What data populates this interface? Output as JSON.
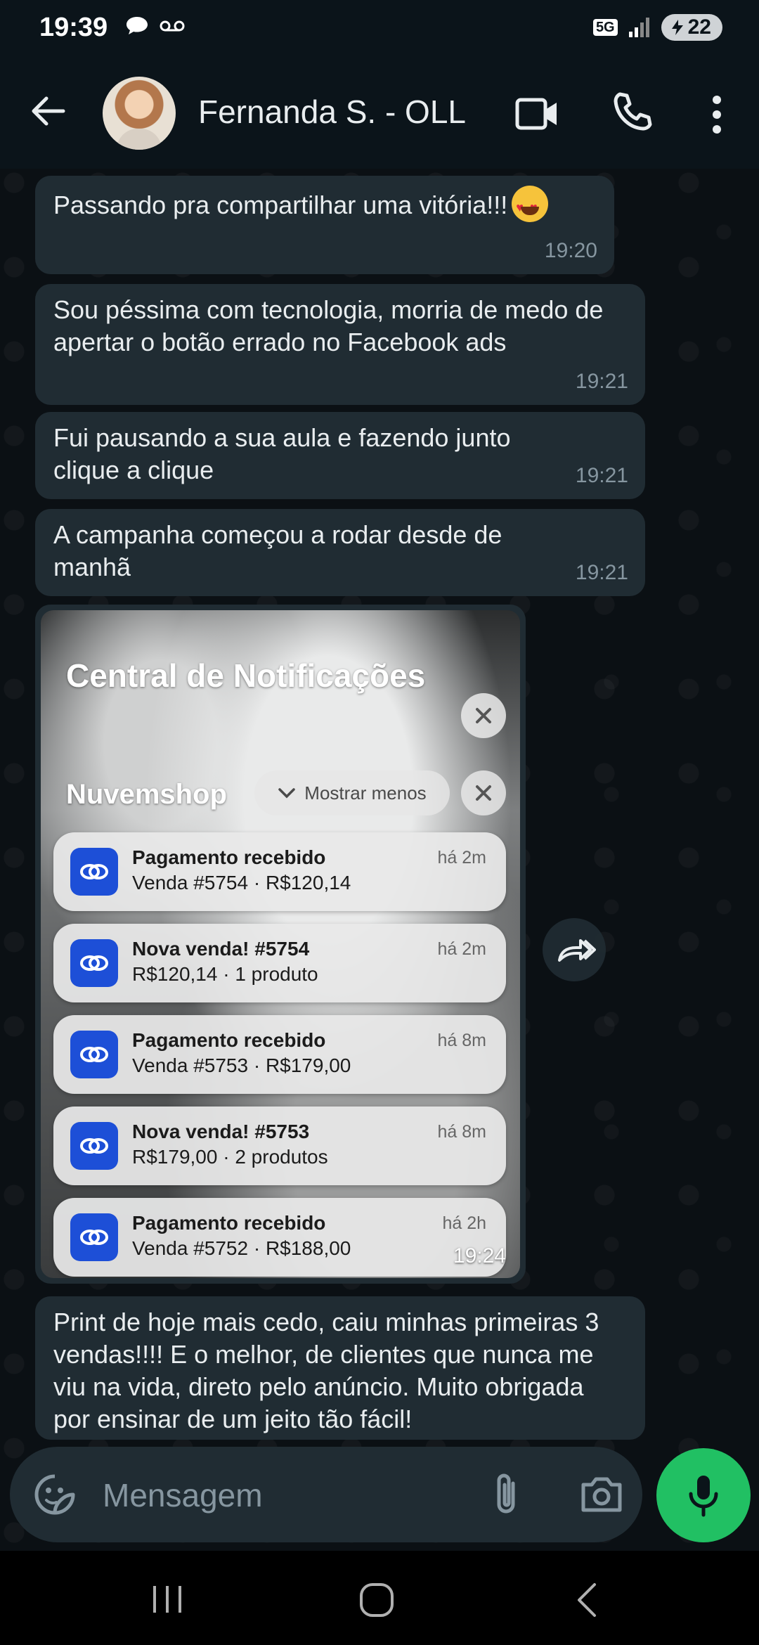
{
  "status_bar": {
    "time": "19:39",
    "network": "5G",
    "battery": "22"
  },
  "chat_header": {
    "contact_name": "Fernanda S. - OLL"
  },
  "messages": [
    {
      "text": "Passando pra compartilhar uma vitória!!!",
      "emoji": "heart-eyes-emoji",
      "time": "19:20"
    },
    {
      "text": "Sou péssima com tecnologia, morria de medo de apertar o botão errado no Facebook ads",
      "time": "19:21"
    },
    {
      "text": "Fui pausando a sua aula e fazendo junto clique a clique",
      "time": "19:21"
    },
    {
      "text": "A campanha começou a rodar desde de manhã",
      "time": "19:21"
    }
  ],
  "image_message": {
    "time": "19:24",
    "notification_center_title": "Central de Notificações",
    "group_name": "Nuvemshop",
    "show_less_label": "Mostrar menos",
    "notifications": [
      {
        "title": "Pagamento recebido",
        "body": "Venda #5754 · R$120,14",
        "time": "há 2m"
      },
      {
        "title": "Nova venda! #5754",
        "body": "R$120,14 · 1 produto",
        "time": "há 2m"
      },
      {
        "title": "Pagamento recebido",
        "body": "Venda #5753 · R$179,00",
        "time": "há 8m"
      },
      {
        "title": "Nova venda! #5753",
        "body": "R$179,00 · 2 produtos",
        "time": "há 8m"
      },
      {
        "title": "Pagamento recebido",
        "body": "Venda #5752 · R$188,00",
        "time": "há 2h"
      }
    ]
  },
  "last_message": {
    "text": "Print de hoje mais cedo, caiu minhas primeiras 3 vendas!!!! E o melhor, de clientes que nunca me viu na vida, direto pelo anúncio. Muito obrigada por ensinar de um jeito tão fácil!"
  },
  "composer": {
    "placeholder": "Mensagem"
  },
  "colors": {
    "bubble": "#202c33",
    "background": "#0b1014",
    "mic": "#21c063",
    "app_icon": "#1d4fd7"
  }
}
